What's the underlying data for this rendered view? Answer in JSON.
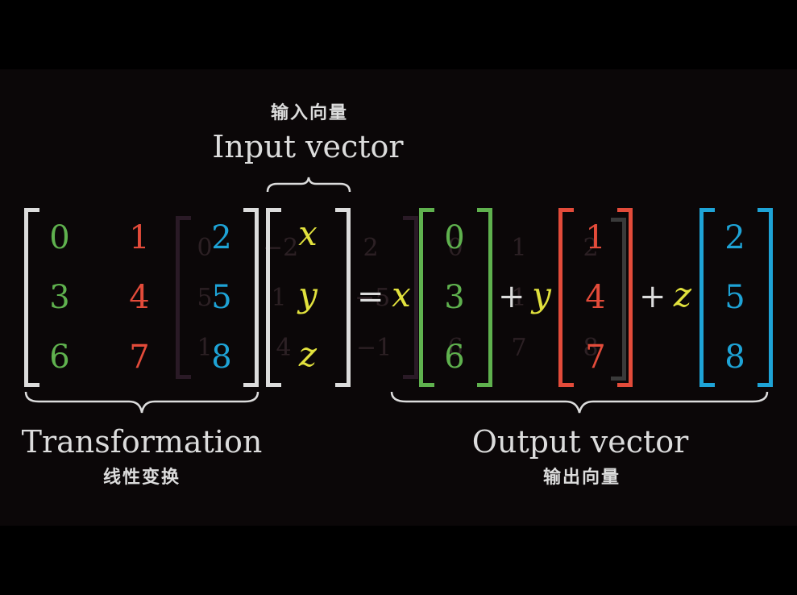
{
  "colors": {
    "background": "#0b0708",
    "white": "#dcdcdc",
    "green": "#5fb14e",
    "red": "#e34b3a",
    "blue": "#1ea3d6",
    "yellow": "#e1e13d",
    "ghost_purple": "#3a2433"
  },
  "labels": {
    "input_cn": "输入向量",
    "input_en": "Input vector",
    "transformation_en": "Transformation",
    "transformation_cn": "线性变换",
    "output_en": "Output vector",
    "output_cn": "输出向量"
  },
  "matrix": {
    "col1": [
      "0",
      "3",
      "6"
    ],
    "col2": [
      "1",
      "4",
      "7"
    ],
    "col3": [
      "2",
      "5",
      "8"
    ]
  },
  "input_vector": [
    "x",
    "y",
    "z"
  ],
  "equation": {
    "equals": "=",
    "plus": "+",
    "coef_x": "x",
    "coef_y": "y",
    "coef_z": "z"
  },
  "output_columns": {
    "col1": [
      "0",
      "3",
      "6"
    ],
    "col2": [
      "1",
      "4",
      "7"
    ],
    "col3": [
      "2",
      "5",
      "8"
    ]
  },
  "ghost_text": {
    "g1": "0",
    "g2": "−2",
    "g3": "2",
    "g4": "5",
    "g5": "1",
    "g6": "−5",
    "g7": "1",
    "g8": "4",
    "g9": "−1",
    "g10": "0",
    "g11": "1",
    "g12": "2",
    "g13": "1",
    "g14": "1",
    "g15": "5",
    "g16": "6",
    "g17": "7",
    "g18": "8"
  }
}
